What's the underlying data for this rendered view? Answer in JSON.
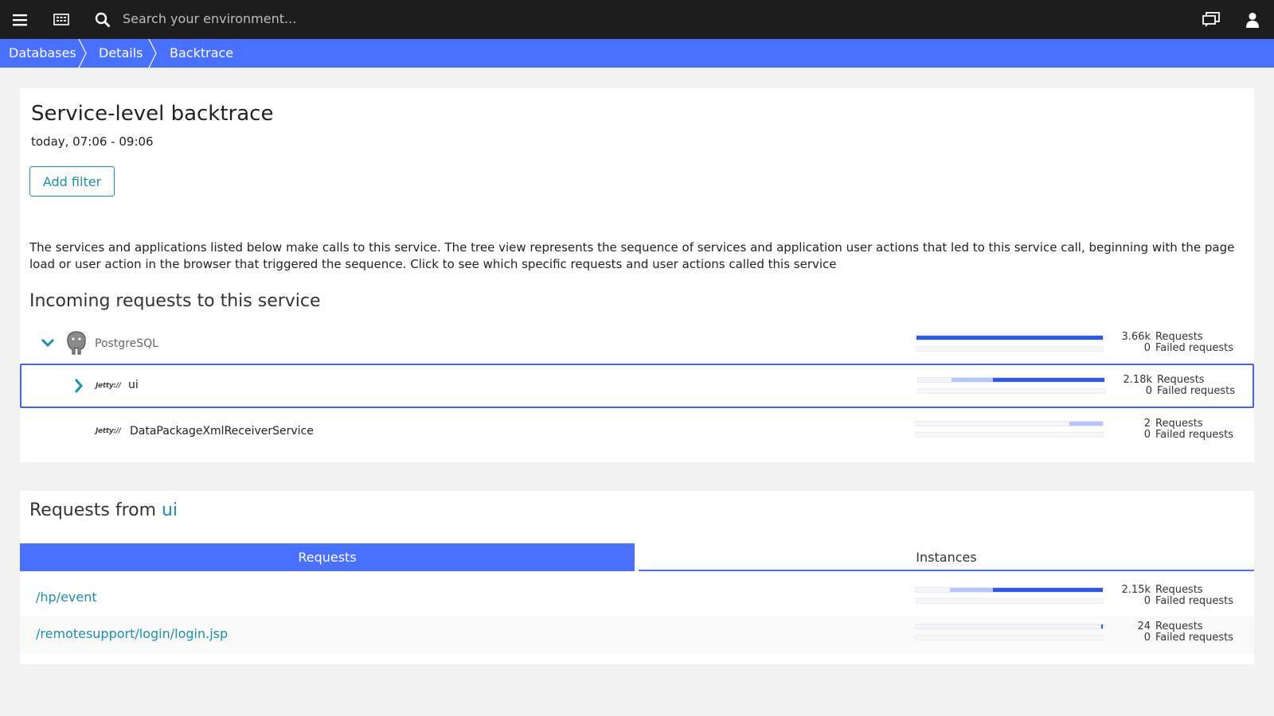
{
  "topbar": {
    "search_placeholder": "Search your environment...",
    "icons": [
      "hamburger-icon",
      "dashboard-icon",
      "search-icon",
      "chat-icon",
      "user-icon"
    ]
  },
  "breadcrumb": [
    "Databases",
    "Details",
    "Backtrace"
  ],
  "backtrace": {
    "title": "Service-level backtrace",
    "timerange": "today, 07:06 - 09:06",
    "add_filter_label": "Add filter",
    "description": "The services and applications listed below make calls to this service. The tree view represents the sequence of services and application user actions that led to this service call, beginning with the page load or user action in the browser that triggered the sequence. Click to see which specific requests and user actions called this service",
    "incoming_heading": "Incoming requests to this service",
    "rows": [
      {
        "name": "PostgreSQL",
        "icon": "postgresql-icon",
        "requests": "3.66k",
        "requests_label": "Requests",
        "failed": "0",
        "failed_label": "Failed requests",
        "bar_light": 0,
        "bar_dark": 1.0
      },
      {
        "name": "ui",
        "icon": "jetty-icon",
        "icon_text": "Jetty://",
        "requests": "2.18k",
        "requests_label": "Requests",
        "failed": "0",
        "failed_label": "Failed requests",
        "bar_light": 0.22,
        "bar_dark": 0.6
      },
      {
        "name": "DataPackageXmlReceiverService",
        "icon": "jetty-icon",
        "icon_text": "Jetty://",
        "requests": "2",
        "requests_label": "Requests",
        "failed": "0",
        "failed_label": "Failed requests",
        "bar_light": 0.18,
        "bar_dark": 0.0
      }
    ]
  },
  "requests_from": {
    "heading_prefix": "Requests from",
    "heading_link": "ui",
    "tabs": [
      "Requests",
      "Instances"
    ],
    "active_tab": "Requests",
    "rows": [
      {
        "path": "/hp/event",
        "requests": "2.15k",
        "requests_label": "Requests",
        "failed": "0",
        "failed_label": "Failed requests",
        "bar_light": 0.23,
        "bar_dark": 0.59
      },
      {
        "path": "/remotesupport/login/login.jsp",
        "requests": "24",
        "requests_label": "Requests",
        "failed": "0",
        "failed_label": "Failed requests",
        "bar_light": 0,
        "bar_dark": 0.01
      }
    ]
  },
  "colors": {
    "accent": "#4a70ff",
    "link": "#1c8fb0",
    "bar_dark": "#2f57e8",
    "bar_light": "#b7c6fb"
  }
}
